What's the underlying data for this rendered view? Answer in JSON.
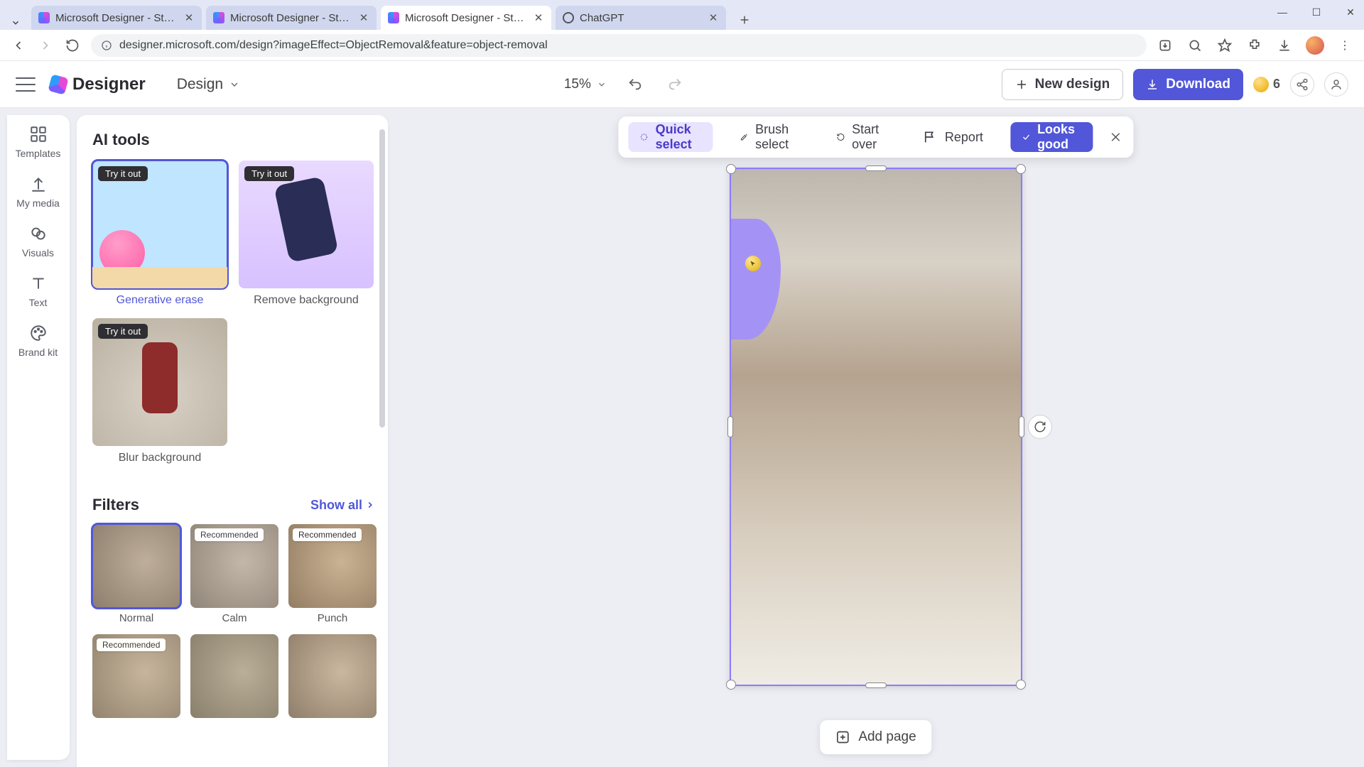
{
  "browser": {
    "tabs": [
      {
        "title": "Microsoft Designer - Stunning",
        "active": false
      },
      {
        "title": "Microsoft Designer - Stunning",
        "active": false
      },
      {
        "title": "Microsoft Designer - Stunning",
        "active": true
      },
      {
        "title": "ChatGPT",
        "active": false
      }
    ],
    "url": "designer.microsoft.com/design?imageEffect=ObjectRemoval&feature=object-removal"
  },
  "header": {
    "brand": "Designer",
    "menu_label": "Design",
    "zoom": "15%",
    "new_design": "New design",
    "download": "Download",
    "coins": "6"
  },
  "rail": {
    "templates": "Templates",
    "my_media": "My media",
    "visuals": "Visuals",
    "text": "Text",
    "brand_kit": "Brand kit"
  },
  "panel": {
    "ai_title": "AI tools",
    "try_badge": "Try it out",
    "tools": {
      "generative_erase": "Generative erase",
      "remove_background": "Remove background",
      "blur_background": "Blur background"
    },
    "filters_title": "Filters",
    "show_all": "Show all",
    "recommended_badge": "Recommended",
    "filters": {
      "normal": "Normal",
      "calm": "Calm",
      "punch": "Punch"
    }
  },
  "toolbar": {
    "quick_select": "Quick select",
    "brush_select": "Brush select",
    "start_over": "Start over",
    "report": "Report",
    "looks_good": "Looks good"
  },
  "canvas": {
    "add_page": "Add page"
  }
}
